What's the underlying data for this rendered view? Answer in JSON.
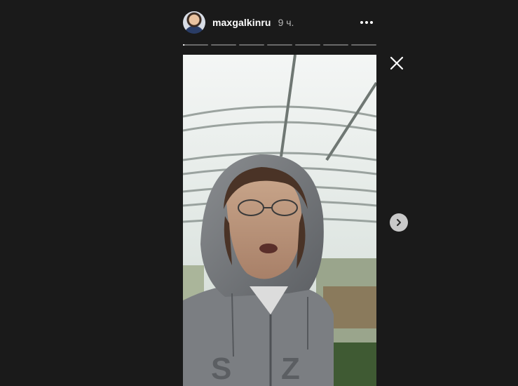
{
  "header": {
    "username": "maxgalkinru",
    "time": "9 ч."
  },
  "progress": {
    "segments": 7,
    "current_index": 0,
    "current_fraction": 0.05
  },
  "icons": {
    "avatar": "profile-avatar",
    "more": "more-options-icon",
    "close": "close-icon",
    "next": "chevron-right-icon"
  },
  "colors": {
    "background": "#1a1a1a",
    "text": "#ffffff",
    "muted": "#b8b8b8",
    "next_button": "#c9c9c9"
  }
}
